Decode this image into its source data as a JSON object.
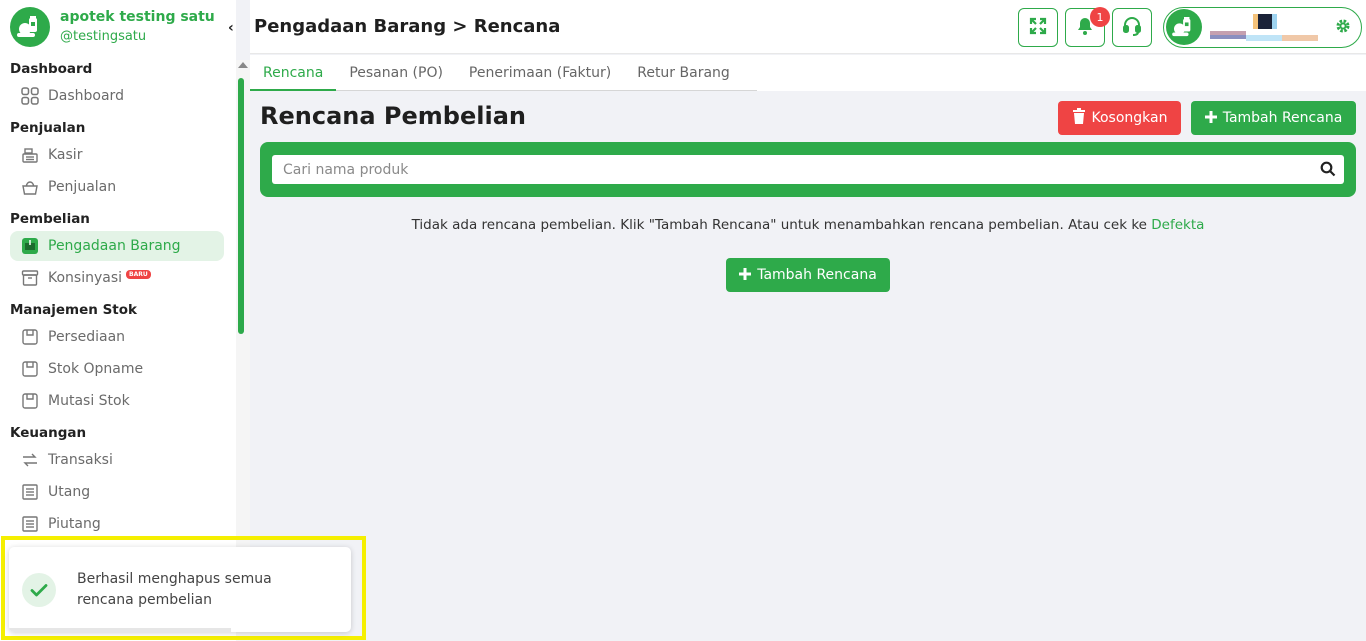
{
  "sidebar": {
    "brand_name": "apotek testing satu",
    "brand_handle": "@testingsatu",
    "collapse_glyph": "‹",
    "groups": [
      {
        "label": "Dashboard",
        "items": [
          {
            "label": "Dashboard",
            "icon": "grid-icon"
          }
        ]
      },
      {
        "label": "Penjualan",
        "items": [
          {
            "label": "Kasir",
            "icon": "cash-register-icon"
          },
          {
            "label": "Penjualan",
            "icon": "basket-icon"
          }
        ]
      },
      {
        "label": "Pembelian",
        "items": [
          {
            "label": "Pengadaan Barang",
            "icon": "box-icon",
            "active": true
          },
          {
            "label": "Konsinyasi",
            "icon": "archive-icon",
            "badge": "BARU"
          }
        ]
      },
      {
        "label": "Manajemen Stok",
        "items": [
          {
            "label": "Persediaan",
            "icon": "package-icon"
          },
          {
            "label": "Stok Opname",
            "icon": "package-icon"
          },
          {
            "label": "Mutasi Stok",
            "icon": "package-icon"
          }
        ]
      },
      {
        "label": "Keuangan",
        "items": [
          {
            "label": "Transaksi",
            "icon": "transfer-icon"
          },
          {
            "label": "Utang",
            "icon": "receipt-icon"
          },
          {
            "label": "Piutang",
            "icon": "receipt-icon"
          }
        ]
      }
    ]
  },
  "header": {
    "title": "Pengadaan Barang > Rencana",
    "notification_count": "1"
  },
  "tabs": [
    {
      "label": "Rencana",
      "active": true
    },
    {
      "label": "Pesanan (PO)"
    },
    {
      "label": "Penerimaan (Faktur)"
    },
    {
      "label": "Retur Barang"
    }
  ],
  "main": {
    "title": "Rencana Pembelian",
    "clear_button": "Kosongkan",
    "add_button": "Tambah Rencana",
    "search_placeholder": "Cari nama produk",
    "empty_text": "Tidak ada rencana pembelian. Klik \"Tambah Rencana\" untuk menambahkan rencana pembelian. Atau cek ke ",
    "empty_link": "Defekta",
    "empty_add_button": "Tambah Rencana"
  },
  "toast": {
    "message": "Berhasil menghapus semua rencana pembelian",
    "progress_fraction": 0.65
  },
  "colors": {
    "primary": "#2eaa4a",
    "danger": "#ef4444",
    "highlight": "#f5ef00"
  }
}
